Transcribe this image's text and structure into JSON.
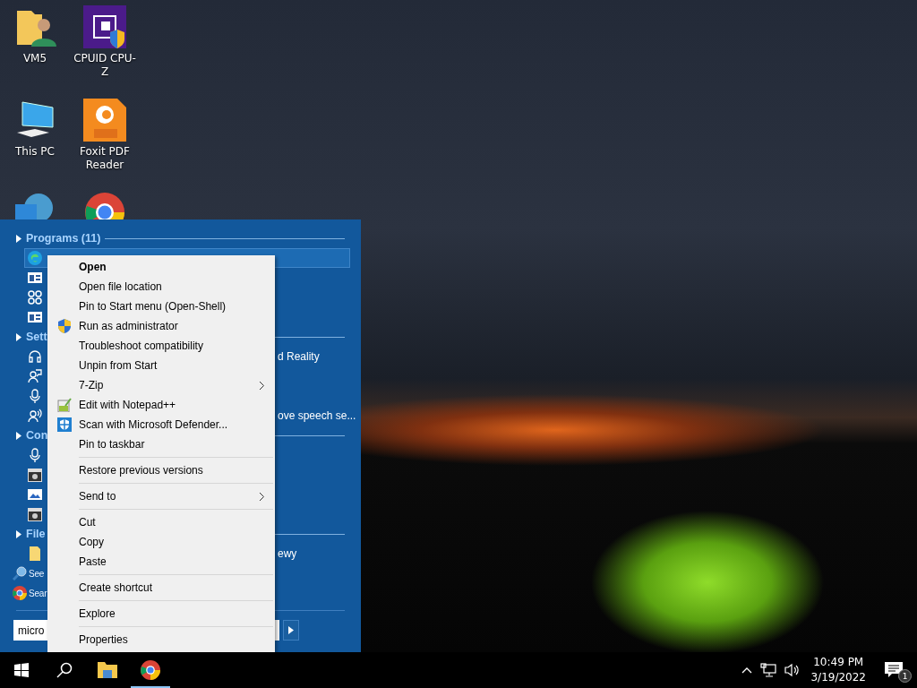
{
  "desktop_icons": [
    {
      "kind": "user-folder",
      "label": "VM5"
    },
    {
      "kind": "chip",
      "label": "CPUID CPU-Z"
    },
    {
      "kind": "computer",
      "label": "This PC"
    },
    {
      "kind": "pdf",
      "label": "Foxit PDF Reader"
    },
    {
      "kind": "globe"
    },
    {
      "kind": "browser"
    }
  ],
  "start_menu": {
    "sections": [
      {
        "title": "Programs (11)",
        "items": [
          {
            "kind": "edge",
            "selected": true
          },
          {
            "kind": "window",
            "selected": false
          },
          {
            "kind": "knot",
            "selected": false
          },
          {
            "kind": "window",
            "selected": false
          }
        ]
      },
      {
        "title": "Sett",
        "items": [
          {
            "tail": "d Reality",
            "kind": "headset",
            "selected": false
          },
          {
            "kind": "people",
            "selected": false
          },
          {
            "kind": "mic",
            "selected": false
          },
          {
            "tail": "ove speech se...",
            "kind": "speech",
            "selected": false
          }
        ]
      },
      {
        "title": "Con",
        "items": [
          {
            "kind": "mic",
            "selected": false
          },
          {
            "kind": "disk",
            "selected": false
          },
          {
            "kind": "picture",
            "selected": false
          },
          {
            "kind": "disk",
            "selected": false
          }
        ]
      },
      {
        "title": "File",
        "items": [
          {
            "tail": "ewy",
            "kind": "folder",
            "selected": false
          }
        ]
      }
    ],
    "links": [
      {
        "label": "See",
        "kind": "search"
      },
      {
        "label": "Sear",
        "kind": "browser"
      }
    ],
    "search": {
      "value": "micro"
    }
  },
  "context_menu": [
    [
      {
        "label": "Open",
        "default": true,
        "kind": "plain",
        "submenu": false
      },
      {
        "label": "Open file location",
        "default": false,
        "kind": "plain",
        "submenu": false
      },
      {
        "label": "Pin to Start menu (Open-Shell)",
        "default": false,
        "kind": "plain",
        "submenu": false
      },
      {
        "label": "Run as administrator",
        "default": false,
        "kind": "elevated",
        "submenu": false
      },
      {
        "label": "Troubleshoot compatibility",
        "default": false,
        "kind": "plain",
        "submenu": false
      },
      {
        "label": "Unpin from Start",
        "default": false,
        "kind": "plain",
        "submenu": false
      },
      {
        "label": "7-Zip",
        "default": false,
        "kind": "plain",
        "submenu": true
      },
      {
        "label": "Edit with Notepad++",
        "default": false,
        "kind": "editor",
        "submenu": false
      },
      {
        "label": "Scan with Microsoft Defender...",
        "default": false,
        "kind": "scan",
        "submenu": false
      },
      {
        "label": "Pin to taskbar",
        "default": false,
        "kind": "plain",
        "submenu": false
      }
    ],
    [
      {
        "label": "Restore previous versions",
        "default": false,
        "kind": "plain",
        "submenu": false
      }
    ],
    [
      {
        "label": "Send to",
        "default": false,
        "kind": "plain",
        "submenu": true
      }
    ],
    [
      {
        "label": "Cut",
        "default": false,
        "kind": "plain",
        "submenu": false
      },
      {
        "label": "Copy",
        "default": false,
        "kind": "plain",
        "submenu": false
      },
      {
        "label": "Paste",
        "default": false,
        "kind": "plain",
        "submenu": false
      }
    ],
    [
      {
        "label": "Create shortcut",
        "default": false,
        "kind": "plain",
        "submenu": false
      }
    ],
    [
      {
        "label": "Explore",
        "default": false,
        "kind": "plain",
        "submenu": false
      }
    ],
    [
      {
        "label": "Properties",
        "default": false,
        "kind": "plain",
        "submenu": false
      }
    ]
  ],
  "taskbar": {
    "buttons": [
      {
        "kind": "start",
        "running": false
      },
      {
        "kind": "search",
        "running": false
      },
      {
        "kind": "folder",
        "running": false
      },
      {
        "kind": "browser",
        "running": true
      }
    ],
    "clock": {
      "time": "10:49 PM",
      "date": "3/19/2022"
    },
    "notifications": {
      "count": "1"
    }
  }
}
